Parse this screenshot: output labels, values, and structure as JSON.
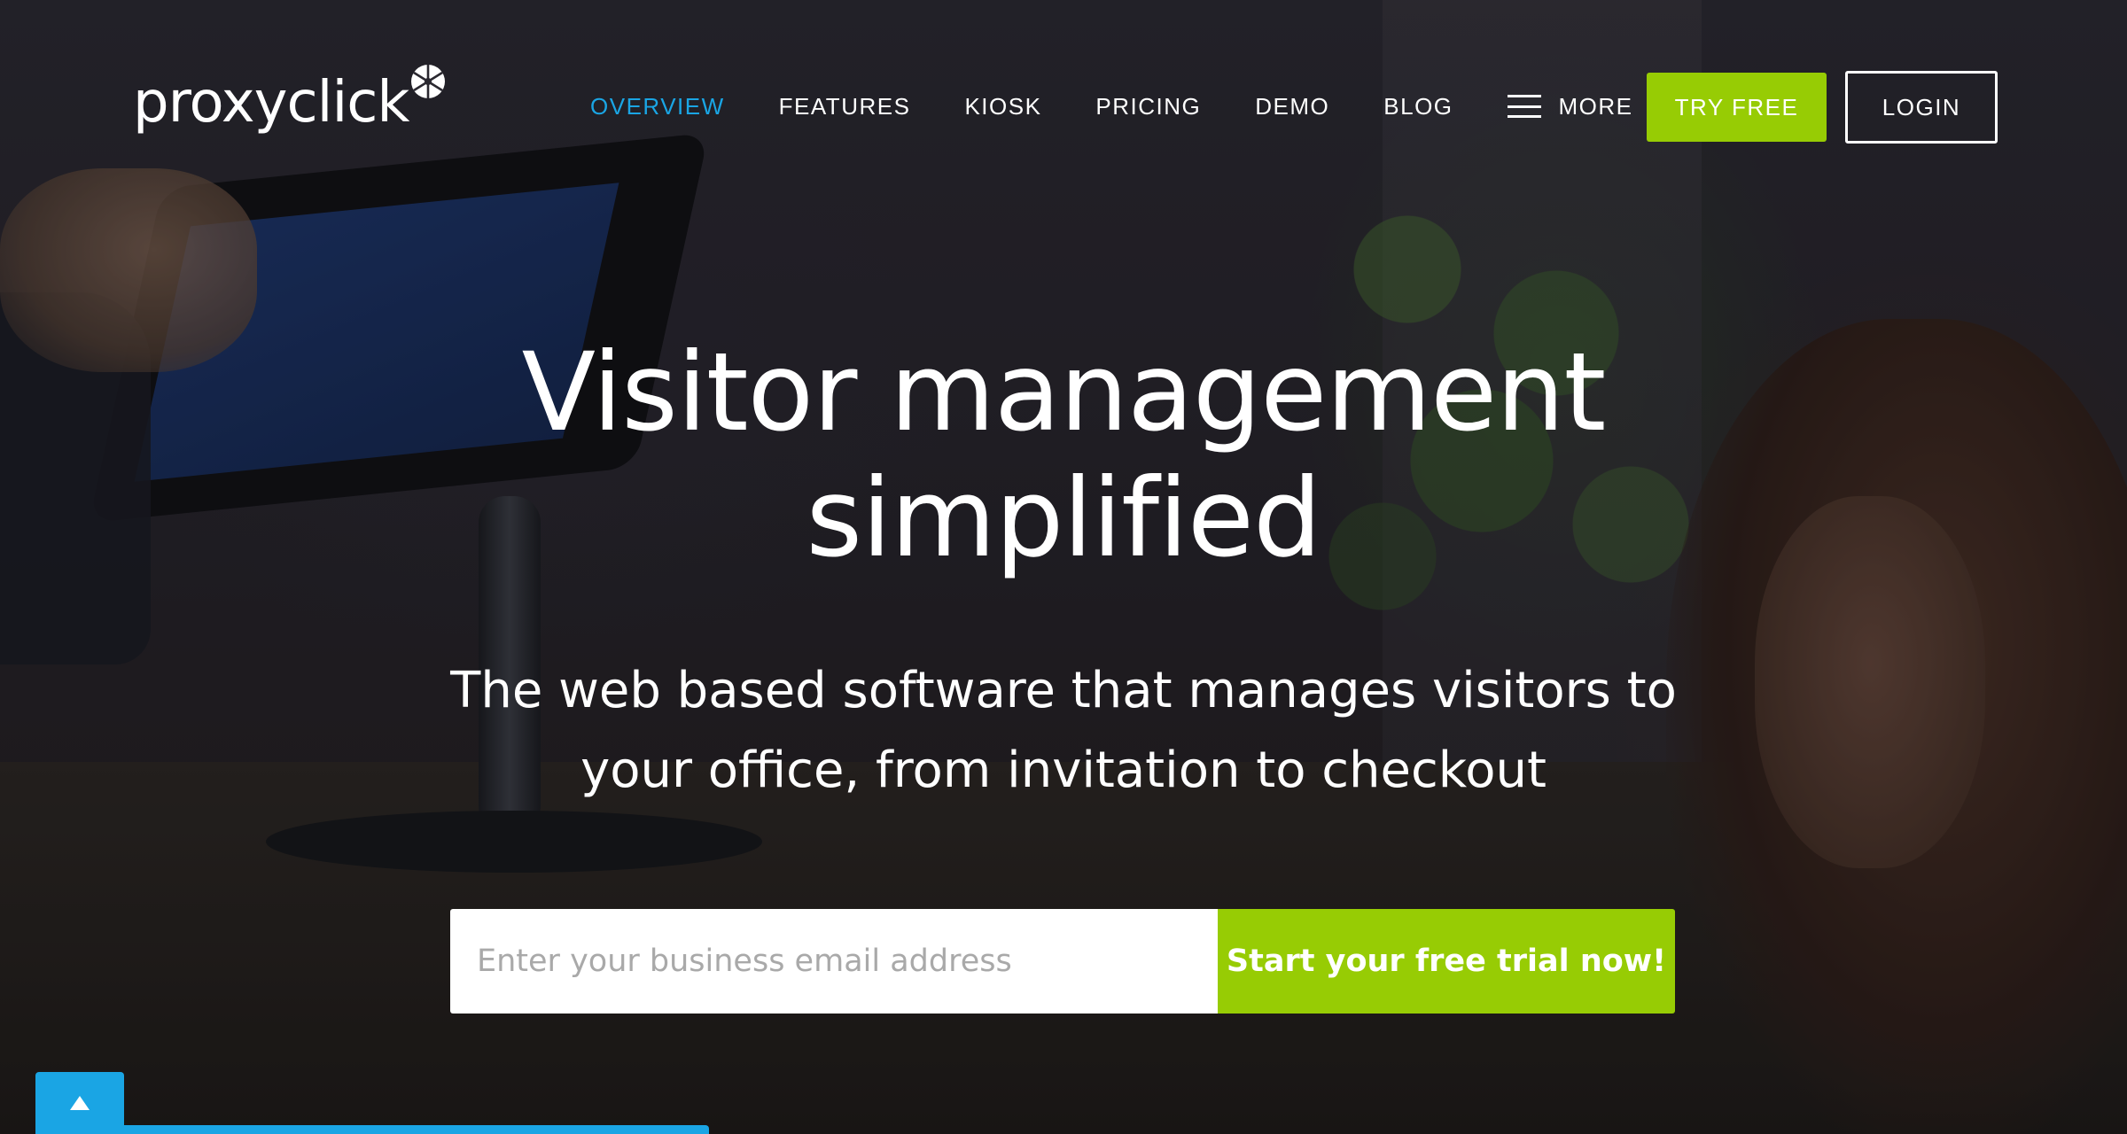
{
  "header": {
    "logo_text": "proxyclick",
    "nav": [
      {
        "label": "OVERVIEW",
        "active": true
      },
      {
        "label": "FEATURES",
        "active": false
      },
      {
        "label": "KIOSK",
        "active": false
      },
      {
        "label": "PRICING",
        "active": false
      },
      {
        "label": "DEMO",
        "active": false
      },
      {
        "label": "BLOG",
        "active": false
      }
    ],
    "more_label": "MORE",
    "try_free_label": "TRY FREE",
    "login_label": "LOGIN"
  },
  "hero": {
    "headline_line1": "Visitor management",
    "headline_line2": "simplified",
    "subhead_line1": "The web based software that manages visitors to",
    "subhead_line2": "your office, from invitation to checkout",
    "email_placeholder": "Enter your business email address",
    "email_value": "",
    "cta_label": "Start your free trial now!"
  },
  "icons": {
    "logo_mark": "pinwheel-icon",
    "more": "hamburger-menu-icon",
    "scroll_up": "triangle-up-icon"
  },
  "colors": {
    "accent_blue": "#1aa5e4",
    "accent_green": "#97cc04",
    "text": "#ffffff"
  }
}
